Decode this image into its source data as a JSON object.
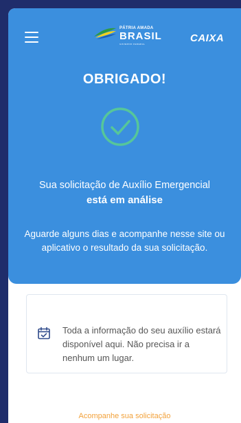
{
  "header": {
    "logo_brasil_top": "PÁTRIA AMADA",
    "logo_brasil_main": "BRASIL",
    "logo_brasil_sub": "GOVERNO FEDERAL",
    "logo_caixa": "CAIXA",
    "menu_icon": "hamburger-menu-icon"
  },
  "confirmation": {
    "title": "OBRIGADO!",
    "status_icon": "check-circle-icon",
    "message_line1": "Sua solicitação de Auxílio Emergencial",
    "message_line2": "está em análise",
    "instructions": "Aguarde alguns dias e acompanhe nesse site ou aplicativo o resultado da sua solicitação."
  },
  "info_card": {
    "icon": "calendar-check-icon",
    "text": "Toda a informação do seu auxílio estará disponível aqui. Não precisa ir a nenhum um lugar."
  },
  "footer": {
    "follow_link": "Acompanhe sua solicitação"
  },
  "colors": {
    "background": "#1f2d6b",
    "primary_blue": "#3b8fde",
    "check_green": "#56c69a",
    "link_orange": "#f2a13a"
  }
}
